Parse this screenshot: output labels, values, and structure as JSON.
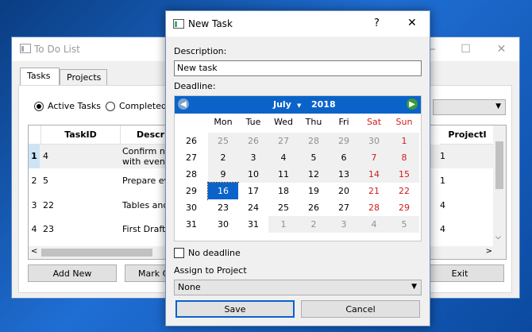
{
  "main_window": {
    "title": "To Do List",
    "tabs": [
      "Tasks",
      "Projects"
    ],
    "filters": {
      "active": "Active Tasks",
      "completed": "Completed T"
    },
    "grid": {
      "headers": {
        "taskid": "TaskID",
        "description": "Descrip",
        "projectid": "ProjectI"
      },
      "rows": [
        {
          "num": "1",
          "taskid": "4",
          "desc1": "Confirm nur",
          "desc2": "with event",
          "proj": "1"
        },
        {
          "num": "2",
          "taskid": "5",
          "desc1": "Prepare eve",
          "desc2": "",
          "proj": "1"
        },
        {
          "num": "3",
          "taskid": "22",
          "desc1": "Tables and",
          "desc2": "",
          "proj": "4"
        },
        {
          "num": "4",
          "taskid": "23",
          "desc1": "First Draft",
          "desc2": "",
          "proj": "4"
        }
      ]
    },
    "buttons": {
      "add_new": "Add New",
      "mark": "Mark C",
      "exit": "Exit"
    }
  },
  "dialog": {
    "title": "New Task",
    "help": "?",
    "close": "✕",
    "description_label": "Description:",
    "description_value": "New task",
    "deadline_label": "Deadline:",
    "calendar": {
      "month": "July",
      "year": "2018",
      "weekdays": [
        "Mon",
        "Tue",
        "Wed",
        "Thu",
        "Fri",
        "Sat",
        "Sun"
      ],
      "weeks": [
        {
          "wk": "26",
          "days": [
            "25",
            "26",
            "27",
            "28",
            "29",
            "30",
            "1"
          ]
        },
        {
          "wk": "27",
          "days": [
            "2",
            "3",
            "4",
            "5",
            "6",
            "7",
            "8"
          ]
        },
        {
          "wk": "28",
          "days": [
            "9",
            "10",
            "11",
            "12",
            "13",
            "14",
            "15"
          ]
        },
        {
          "wk": "29",
          "days": [
            "16",
            "17",
            "18",
            "19",
            "20",
            "21",
            "22"
          ]
        },
        {
          "wk": "30",
          "days": [
            "23",
            "24",
            "25",
            "26",
            "27",
            "28",
            "29"
          ]
        },
        {
          "wk": "31",
          "days": [
            "30",
            "31",
            "1",
            "2",
            "3",
            "4",
            "5"
          ]
        }
      ],
      "selected_day": "16",
      "accent": "#0a63c9",
      "weekend_color": "#d01d1d"
    },
    "no_deadline_label": "No deadline",
    "assign_label": "Assign to Project",
    "project_value": "None",
    "save_label": "Save",
    "cancel_label": "Cancel"
  }
}
